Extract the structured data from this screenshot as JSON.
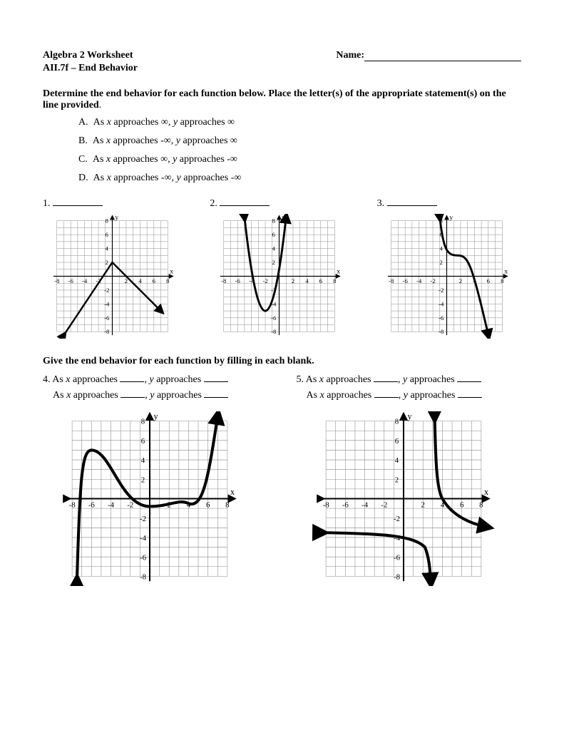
{
  "header": {
    "title": "Algebra 2 Worksheet",
    "name_label": "Name:",
    "subtitle": "AII.7f – End Behavior"
  },
  "instructions": {
    "line1_bold": "Determine the end behavior for each function below.  Place the letter(s) of the appropriate statement(s) on the line provided",
    "period": "."
  },
  "choices": {
    "A": {
      "letter": "A.",
      "pre": "As ",
      "x": "x",
      "mid1": " approaches ∞, ",
      "y": "y",
      "post": " approaches ∞"
    },
    "B": {
      "letter": "B.",
      "pre": "As ",
      "x": "x",
      "mid1": " approaches -∞, ",
      "y": "y",
      "post": " approaches ∞"
    },
    "C": {
      "letter": "C.",
      "pre": "As ",
      "x": "x",
      "mid1": " approaches ∞, ",
      "y": "y",
      "post": " approaches -∞"
    },
    "D": {
      "letter": "D.",
      "pre": "As ",
      "x": "x",
      "mid1": " approaches -∞, ",
      "y": "y",
      "post": " approaches -∞"
    }
  },
  "q": {
    "n1": "1.",
    "n2": "2.",
    "n3": "3."
  },
  "section2": "Give the end behavior for each function by filling in each blank.",
  "fill": {
    "q4": "4. ",
    "q5": "5. ",
    "as": "As ",
    "x": "x",
    "approaches": " approaches ",
    "comma": ", ",
    "y": "y"
  },
  "chart_data": [
    {
      "type": "line",
      "title": "Graph 1",
      "xlabel": "x",
      "ylabel": "y",
      "xlim": [
        -8,
        8
      ],
      "ylim": [
        -8,
        8
      ],
      "x": [
        -8,
        0,
        8
      ],
      "values": [
        -10,
        2,
        -6
      ],
      "description": "Piecewise-linear graph rising from lower-left to a peak near (0,2) then falling to lower-right; end behavior D and C."
    },
    {
      "type": "line",
      "title": "Graph 2",
      "xlabel": "x",
      "ylabel": "y",
      "xlim": [
        -8,
        8
      ],
      "ylim": [
        -8,
        8
      ],
      "x": [
        -6,
        -2,
        1,
        6
      ],
      "values": [
        10,
        -5,
        10,
        10
      ],
      "description": "Upward-opening parabola-like curve with vertex near (-2,-5); both ends rise to +∞ (A and B)."
    },
    {
      "type": "line",
      "title": "Graph 3",
      "xlabel": "x",
      "ylabel": "y",
      "xlim": [
        -8,
        8
      ],
      "ylim": [
        -8,
        8
      ],
      "x": [
        -4,
        0,
        2,
        6
      ],
      "values": [
        10,
        4,
        3,
        -10
      ],
      "description": "Odd-degree-like curve entering from upper-left, flattening near (1,3) then falling to lower-right (B and C)."
    },
    {
      "type": "line",
      "title": "Graph 4",
      "xlabel": "x",
      "ylabel": "y",
      "xlim": [
        -8,
        8
      ],
      "ylim": [
        -8,
        8
      ],
      "x": [
        -8,
        -6,
        -4,
        0,
        4,
        6,
        8
      ],
      "values": [
        -10,
        5,
        2,
        -0.5,
        -0.5,
        2,
        10
      ],
      "description": "Odd-degree polynomial with local max near (-6,5), wiggles near x-axis, rises to +∞ on right and falls to -∞ on left."
    },
    {
      "type": "line",
      "title": "Graph 5",
      "xlabel": "x",
      "ylabel": "y",
      "xlim": [
        -8,
        8
      ],
      "ylim": [
        -8,
        8
      ],
      "series": [
        {
          "name": "left-branch",
          "x": [
            -8,
            0,
            2.8
          ],
          "values": [
            -3.5,
            -3.8,
            -10
          ]
        },
        {
          "name": "right-branch",
          "x": [
            3.2,
            4,
            8
          ],
          "values": [
            10,
            0,
            -3
          ]
        }
      ],
      "asymptote_x": 3,
      "description": "Rational-function-like graph with vertical asymptote near x=3; left side approaches y≈-3.5 as x→-∞ and dives to -∞ near asymptote; right side comes from +∞ and levels toward y≈-3."
    }
  ]
}
